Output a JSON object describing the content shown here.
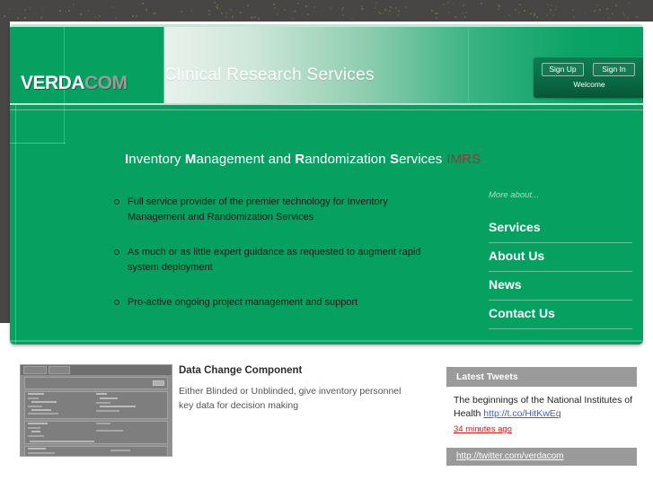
{
  "brand": {
    "name_primary": "VERDA",
    "name_secondary": "COM"
  },
  "header": {
    "site_title": "Clinical Research Services",
    "auth": {
      "sign_up_label": "Sign Up",
      "sign_in_label": "Sign In",
      "welcome_label": "Welcome"
    }
  },
  "hero": {
    "heading_parts": [
      {
        "cap": "I",
        "rest": "nventory "
      },
      {
        "cap": "M",
        "rest": "anagement and "
      },
      {
        "cap": "R",
        "rest": "andomization "
      },
      {
        "cap": "S",
        "rest": "ervices"
      }
    ],
    "heading_acronym": "IMRS",
    "bullets": [
      "Full service provider of the premier technology for Inventory Management and Randomization Services",
      "As much or as little expert guidance as requested to augment rapid system deployment",
      "Pro-active ongoing project management and support"
    ]
  },
  "more_menu": {
    "label": "More about...",
    "items": [
      {
        "label": "Services"
      },
      {
        "label": "About Us"
      },
      {
        "label": "News"
      },
      {
        "label": "Contact Us"
      }
    ]
  },
  "feature": {
    "title": "Data Change Component",
    "description": "Either Blinded or Unblinded, give inventory personnel key data for decision making"
  },
  "tweets": {
    "header": "Latest Tweets",
    "latest": {
      "text": "The beginnings of the National Institutes of Health ",
      "link": "http://t.co/HitKwEq",
      "time": "34 minutes ago"
    },
    "profile_url": "http://twitter.com/verdacom"
  },
  "colors": {
    "brand_green": "#06a161",
    "accent_red": "#8e3b3b",
    "link_blue": "#3a5fd6",
    "time_red": "#e01515",
    "panel_gray": "#9a9a9a",
    "chrome_dark": "#474644"
  }
}
